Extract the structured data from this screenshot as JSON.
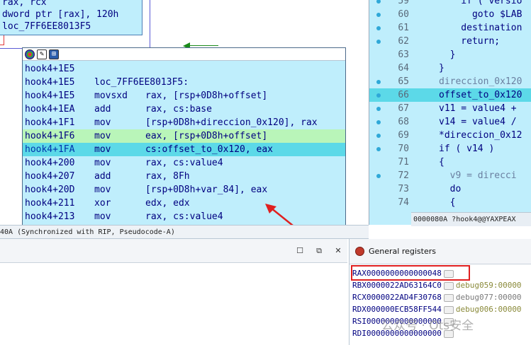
{
  "upper_block": {
    "lines": [
      "rax, rcx",
      "dword ptr [rax], 120h",
      "loc_7FF6EE8013F5"
    ]
  },
  "asm_block": {
    "header_icons": [
      "color-icon",
      "edit-icon",
      "graph-icon"
    ],
    "lines": [
      {
        "addr": "hook4+1E5",
        "mnem": "",
        "ops": ""
      },
      {
        "addr": "hook4+1E5",
        "mnem": "loc_7FF6EE8013F5:",
        "ops": ""
      },
      {
        "addr": "hook4+1E5",
        "mnem": "movsxd",
        "ops": "rax, [rsp+0D8h+offset]"
      },
      {
        "addr": "hook4+1EA",
        "mnem": "add",
        "ops": "rax, cs:base"
      },
      {
        "addr": "hook4+1F1",
        "mnem": "mov",
        "ops": "[rsp+0D8h+direccion_0x120], rax"
      },
      {
        "addr": "hook4+1F6",
        "mnem": "mov",
        "ops": "eax, [rsp+0D8h+offset]"
      },
      {
        "addr": "hook4+1FA",
        "mnem": "mov",
        "ops": "cs:offset_to_0x120, eax"
      },
      {
        "addr": "hook4+200",
        "mnem": "mov",
        "ops": "rax, cs:value4"
      },
      {
        "addr": "hook4+207",
        "mnem": "add",
        "ops": "rax, 8Fh"
      },
      {
        "addr": "hook4+20D",
        "mnem": "mov",
        "ops": "[rsp+0D8h+var_84], eax"
      },
      {
        "addr": "hook4+211",
        "mnem": "xor",
        "ops": "edx, edx"
      },
      {
        "addr": "hook4+213",
        "mnem": "mov",
        "ops": "rax, cs:value4"
      }
    ]
  },
  "status_strip": {
    "text": "40A (Synchronized with RIP, Pseudocode-A)"
  },
  "pseudocode": {
    "lines": [
      {
        "no": "59",
        "text": "    if ( versio",
        "dot": true
      },
      {
        "no": "60",
        "text": "      goto $LAB",
        "dot": true
      },
      {
        "no": "61",
        "text": "    destination",
        "dot": true
      },
      {
        "no": "62",
        "text": "    return;",
        "dot": true
      },
      {
        "no": "63",
        "text": "  }",
        "dot": false
      },
      {
        "no": "64",
        "text": "}",
        "dot": false
      },
      {
        "no": "65",
        "text": "direccion_0x120",
        "dot": true
      },
      {
        "no": "66",
        "text": "offset_to_0x120",
        "dot": true
      },
      {
        "no": "67",
        "text": "v11 = value4 +",
        "dot": true
      },
      {
        "no": "68",
        "text": "v14 = value4 /",
        "dot": true
      },
      {
        "no": "69",
        "text": "*direccion_0x12",
        "dot": true
      },
      {
        "no": "70",
        "text": "if ( v14 )",
        "dot": true
      },
      {
        "no": "71",
        "text": "{",
        "dot": false
      },
      {
        "no": "72",
        "text": "  v9 = direcci",
        "dot": true
      },
      {
        "no": "73",
        "text": "  do",
        "dot": false
      },
      {
        "no": "74",
        "text": "  {",
        "dot": false
      }
    ],
    "status": "0000080A ?hook4@@YAXPEAX"
  },
  "window_buttons": {
    "maximize": "☐",
    "restore": "⧉",
    "close": "✕"
  },
  "registers": {
    "title": "General registers",
    "rows": [
      {
        "name": "RAX",
        "value": "0000000000000048",
        "comment": ""
      },
      {
        "name": "RBX",
        "value": "0000022AD63164C0",
        "comment": "debug059:00000"
      },
      {
        "name": "RCX",
        "value": "0000022AD4F30768",
        "comment": "debug077:00000"
      },
      {
        "name": "RDX",
        "value": "000000ECB58FF544",
        "comment": "debug006:00000"
      },
      {
        "name": "RSI",
        "value": "0000000000000000",
        "comment": ""
      },
      {
        "name": "RDI",
        "value": "0000000000000000",
        "comment": ""
      }
    ]
  },
  "watermark": "公众号 · Ots安全",
  "colors": {
    "highlight_cyan": "#5cd9e8",
    "highlight_green": "#b9f5b9",
    "block_bg": "#bfeefc",
    "annotation_red": "#e02020"
  }
}
